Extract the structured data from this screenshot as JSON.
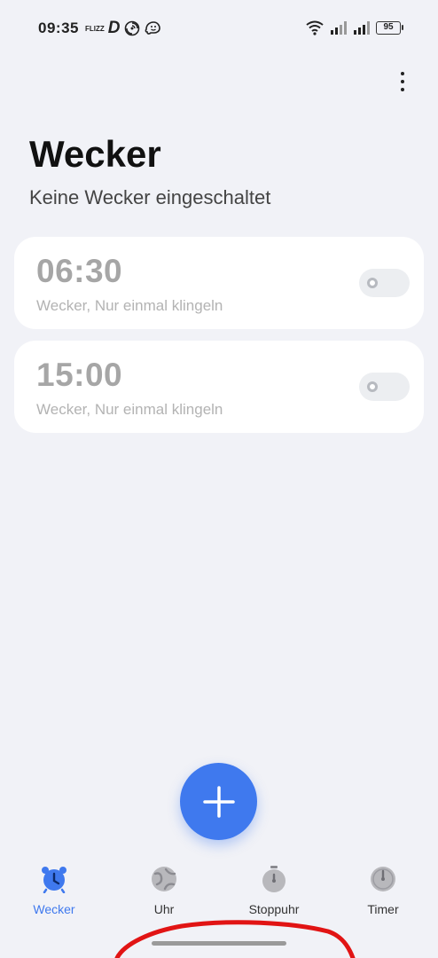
{
  "status_bar": {
    "time": "09:35",
    "notif_flizz": "FLIZZ",
    "notif_d": "D",
    "battery": "95"
  },
  "header": {
    "title": "Wecker",
    "subtitle": "Keine Wecker eingeschaltet"
  },
  "alarms": [
    {
      "time": "06:30",
      "description": "Wecker, Nur einmal klingeln",
      "enabled": false
    },
    {
      "time": "15:00",
      "description": "Wecker, Nur einmal klingeln",
      "enabled": false
    }
  ],
  "bottom_nav": {
    "items": [
      {
        "label": "Wecker",
        "icon": "alarm-clock-icon",
        "active": true
      },
      {
        "label": "Uhr",
        "icon": "globe-icon",
        "active": false
      },
      {
        "label": "Stoppuhr",
        "icon": "stopwatch-icon",
        "active": false
      },
      {
        "label": "Timer",
        "icon": "timer-icon",
        "active": false
      }
    ]
  },
  "colors": {
    "background": "#f1f2f7",
    "accent": "#3f79ee",
    "card": "#ffffff",
    "disabled_text": "#a6a6a6",
    "annotation": "#e11414"
  }
}
